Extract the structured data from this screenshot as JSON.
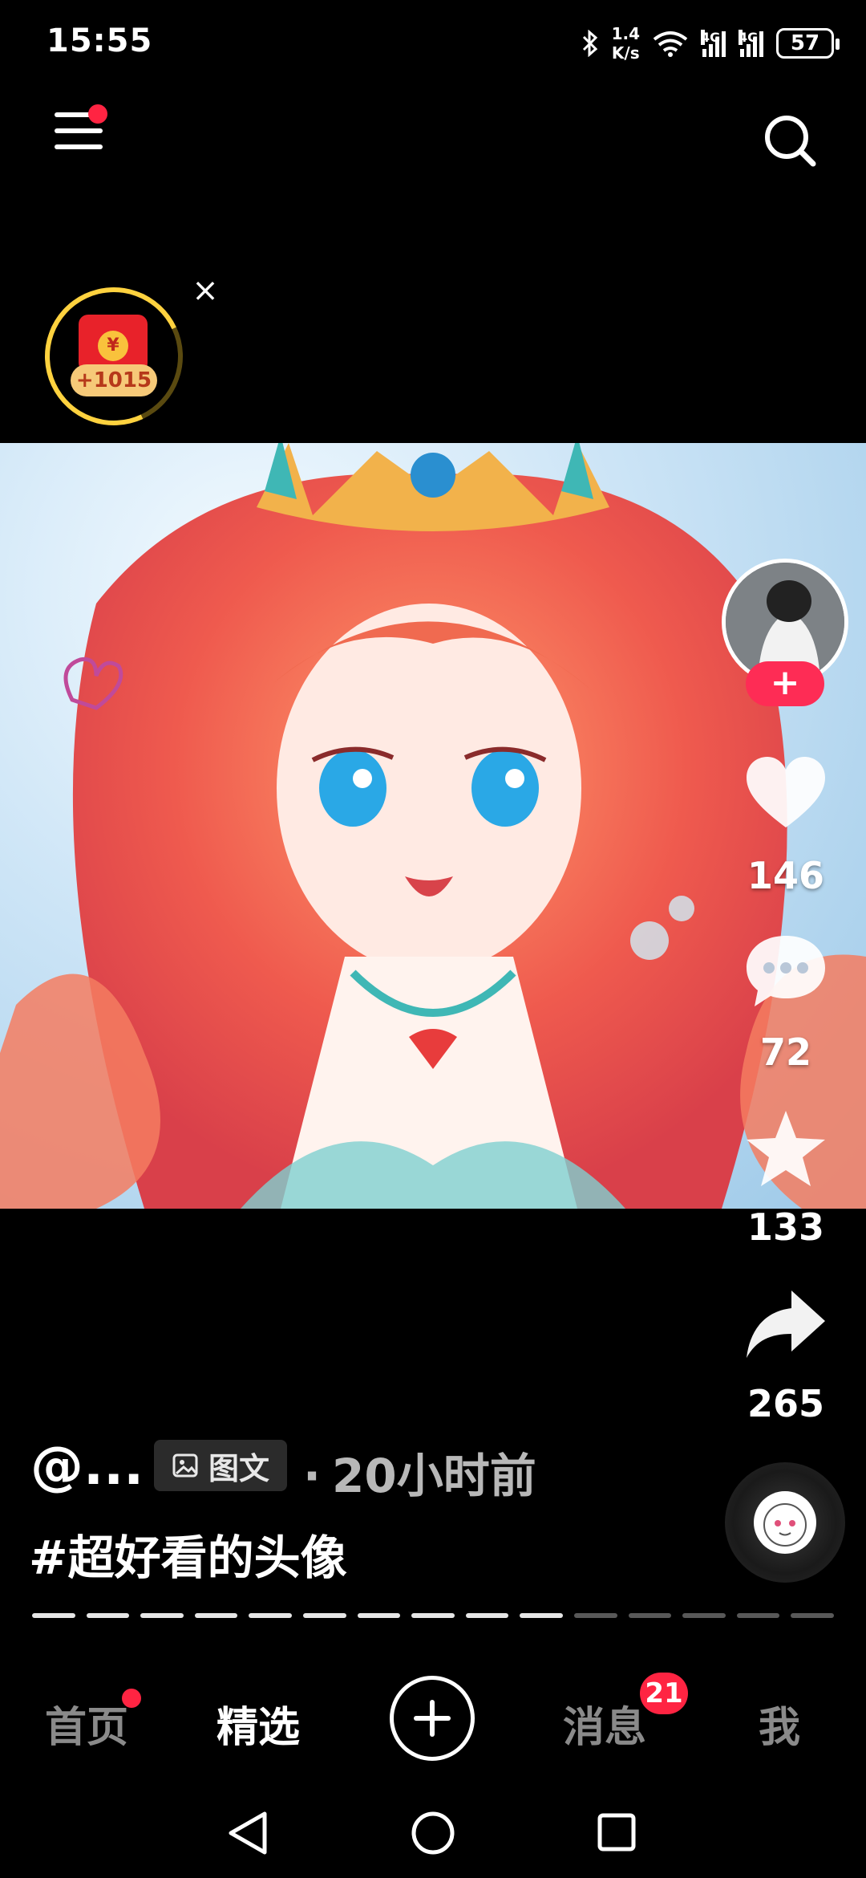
{
  "status_bar": {
    "time": "15:55",
    "net_speed_value": "1.4",
    "net_speed_unit": "K/s",
    "signal_1": "4G",
    "signal_2": "4G",
    "battery": "57"
  },
  "red_packet": {
    "coin_symbol": "¥",
    "amount": "+1015",
    "close": "×"
  },
  "post": {
    "author": "@...",
    "type_badge": "图文",
    "time_ago": "20小时前",
    "time_separator": "·",
    "hashtag": "#超好看的头像",
    "page_progress": {
      "total": 15,
      "current": 10
    }
  },
  "actions": {
    "follow": "+",
    "likes": "146",
    "comments": "72",
    "favorites": "133",
    "shares": "265"
  },
  "bottom_nav": {
    "home": "首页",
    "featured": "精选",
    "messages": "消息",
    "messages_badge": "21",
    "me": "我"
  },
  "colors": {
    "accent": "#fe2c55",
    "badge": "#ff2442",
    "ring": "#ffd23f"
  },
  "icons": [
    "menu-icon",
    "search-icon",
    "red-packet-icon",
    "close-icon",
    "heart-icon",
    "comment-icon",
    "star-icon",
    "share-icon",
    "image-text-icon",
    "add-icon",
    "back-icon",
    "home-circle-icon",
    "recents-icon"
  ]
}
